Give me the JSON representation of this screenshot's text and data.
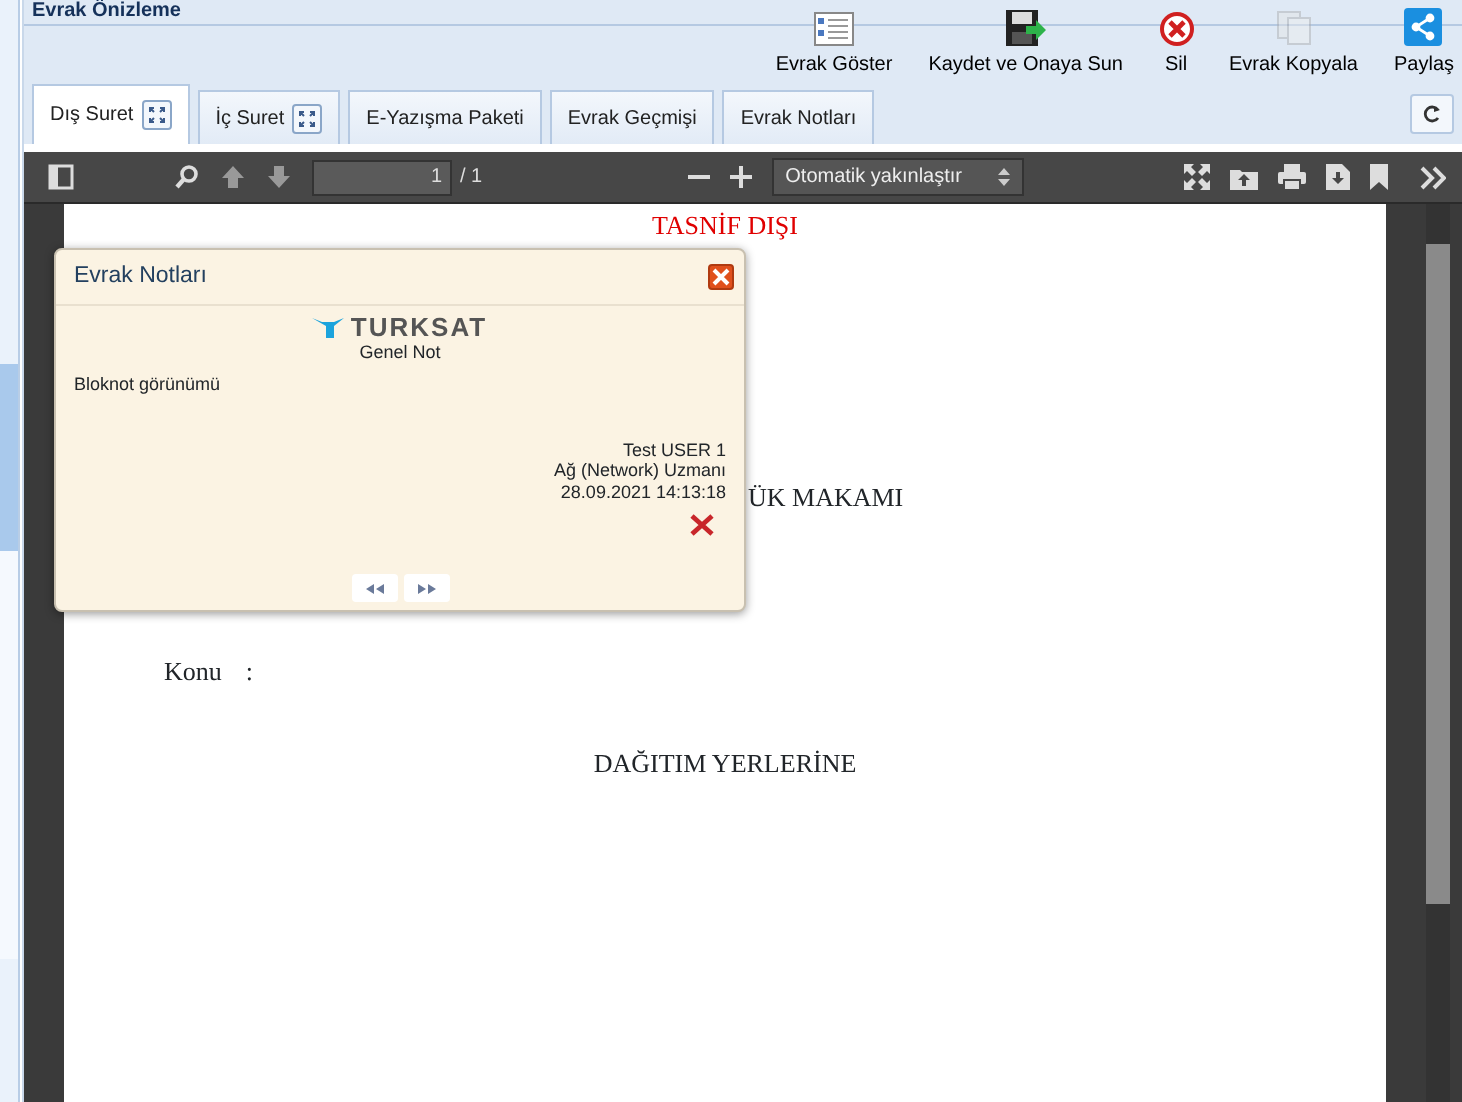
{
  "window": {
    "title": "Evrak Önizleme"
  },
  "toolbar": [
    {
      "kind": "list",
      "label": "Evrak Göster",
      "disabled": false
    },
    {
      "kind": "save",
      "label": "Kaydet ve Onaya Sun",
      "disabled": false
    },
    {
      "kind": "delete",
      "label": "Sil",
      "disabled": false
    },
    {
      "kind": "copy",
      "label": "Evrak Kopyala",
      "disabled": true
    },
    {
      "kind": "share",
      "label": "Paylaş",
      "disabled": false
    }
  ],
  "tabs": [
    {
      "label": "Dış Suret",
      "selected": true,
      "expandable": true
    },
    {
      "label": "İç Suret",
      "selected": false,
      "expandable": true
    },
    {
      "label": "E-Yazışma Paketi",
      "selected": false,
      "expandable": false
    },
    {
      "label": "Evrak Geçmişi",
      "selected": false,
      "expandable": false
    },
    {
      "label": "Evrak Notları",
      "selected": false,
      "expandable": false
    }
  ],
  "pdf_toolbar": {
    "page": "1",
    "page_count": "/ 1",
    "zoom": "Otomatik yakınlaştır"
  },
  "document": {
    "classification": "TASNİF DIŞI",
    "addressee": "ÜK MAKAMI",
    "subject_label": "Konu",
    "subject_sep": ":",
    "distribution": "DAĞITIM YERLERİNE"
  },
  "note_popup": {
    "title": "Evrak Notları",
    "logo": "TURKSAT",
    "note_type": "Genel Not",
    "body": "Bloknot görünümü",
    "author": "Test USER 1",
    "role": "Ağ (Network) Uzmanı",
    "date": "28.09.2021 14:13:18"
  }
}
